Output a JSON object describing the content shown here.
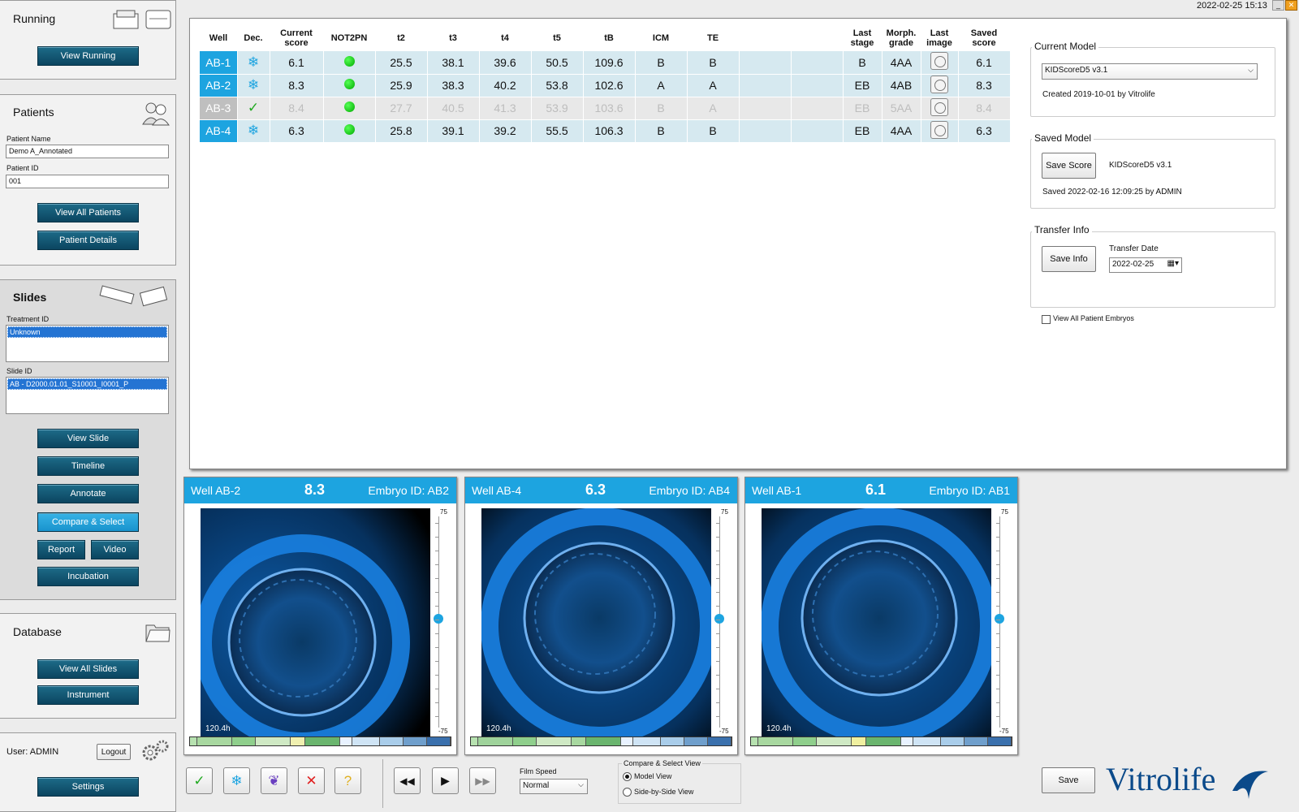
{
  "datetime": "2022-02-25 15:13",
  "window_controls": [
    "_",
    "X"
  ],
  "sidebar": {
    "running": {
      "title": "Running",
      "view_running": "View Running"
    },
    "patients": {
      "title": "Patients",
      "patient_name_label": "Patient Name",
      "patient_name": "Demo A_Annotated",
      "patient_id_label": "Patient ID",
      "patient_id": "001",
      "view_all": "View All Patients",
      "details": "Patient Details"
    },
    "slides": {
      "title": "Slides",
      "treatment_label": "Treatment ID",
      "treatment_value": "Unknown",
      "slide_label": "Slide ID",
      "slide_value": "AB - D2000.01.01_S10001_I0001_P",
      "buttons": {
        "view_slide": "View Slide",
        "timeline": "Timeline",
        "annotate": "Annotate",
        "compare": "Compare & Select",
        "report": "Report",
        "video": "Video",
        "incubation": "Incubation"
      }
    },
    "database": {
      "title": "Database",
      "view_all_slides": "View All Slides",
      "instrument": "Instrument"
    },
    "user": {
      "label": "User: ADMIN",
      "logout": "Logout",
      "settings": "Settings"
    }
  },
  "table": {
    "headers": [
      "Well",
      "Dec.",
      "Current\nscore",
      "NOT2PN",
      "t2",
      "t3",
      "t4",
      "t5",
      "tB",
      "ICM",
      "TE",
      "",
      "",
      "Last\nstage",
      "Morph.\ngrade",
      "Last\nimage",
      "Saved\nscore"
    ],
    "rows": [
      {
        "well": "AB-1",
        "dec": "freeze",
        "score": "6.1",
        "t2": "25.5",
        "t3": "38.1",
        "t4": "39.6",
        "t5": "50.5",
        "tB": "109.6",
        "icm": "B",
        "te": "B",
        "last_stage": "B",
        "morph": "4AA",
        "saved": "6.1",
        "dim": false
      },
      {
        "well": "AB-2",
        "dec": "freeze",
        "score": "8.3",
        "t2": "25.9",
        "t3": "38.3",
        "t4": "40.2",
        "t5": "53.8",
        "tB": "102.6",
        "icm": "A",
        "te": "A",
        "last_stage": "EB",
        "morph": "4AB",
        "saved": "8.3",
        "dim": false
      },
      {
        "well": "AB-3",
        "dec": "check",
        "score": "8.4",
        "t2": "27.7",
        "t3": "40.5",
        "t4": "41.3",
        "t5": "53.9",
        "tB": "103.6",
        "icm": "B",
        "te": "A",
        "last_stage": "EB",
        "morph": "5AA",
        "saved": "8.4",
        "dim": true
      },
      {
        "well": "AB-4",
        "dec": "freeze",
        "score": "6.3",
        "t2": "25.8",
        "t3": "39.1",
        "t4": "39.2",
        "t5": "55.5",
        "tB": "106.3",
        "icm": "B",
        "te": "B",
        "last_stage": "EB",
        "morph": "4AA",
        "saved": "6.3",
        "dim": false
      }
    ]
  },
  "model": {
    "current_title": "Current Model",
    "current_value": "KIDScoreD5 v3.1",
    "created": "Created 2019-10-01 by Vitrolife",
    "saved_title": "Saved Model",
    "save_score": "Save Score",
    "saved_name": "KIDScoreD5 v3.1",
    "saved_info": "Saved 2022-02-16 12:09:25 by ADMIN",
    "transfer_title": "Transfer Info",
    "save_info": "Save Info",
    "transfer_date_label": "Transfer Date",
    "transfer_date": "2022-02-25",
    "view_all_embryos": "View All Patient Embryos"
  },
  "cards": [
    {
      "well": "Well AB-2",
      "score": "8.3",
      "embryo": "Embryo ID: AB2",
      "time": "120.4h",
      "scale_top": "75",
      "scale_bottom": "-75"
    },
    {
      "well": "Well AB-4",
      "score": "6.3",
      "embryo": "Embryo ID: AB4",
      "time": "120.4h",
      "scale_top": "75",
      "scale_bottom": "-75"
    },
    {
      "well": "Well AB-1",
      "score": "6.1",
      "embryo": "Embryo ID: AB1",
      "time": "120.4h",
      "scale_top": "75",
      "scale_bottom": "-75"
    }
  ],
  "bottom": {
    "film_speed_label": "Film Speed",
    "film_speed": "Normal",
    "compare_label": "Compare & Select View",
    "model_view": "Model View",
    "side_view": "Side-by-Side View",
    "save": "Save",
    "brand": "Vitrolife"
  },
  "colors": {
    "accent": "#1da4e0",
    "button": "#0e5472",
    "row": "#d6e9f0"
  }
}
